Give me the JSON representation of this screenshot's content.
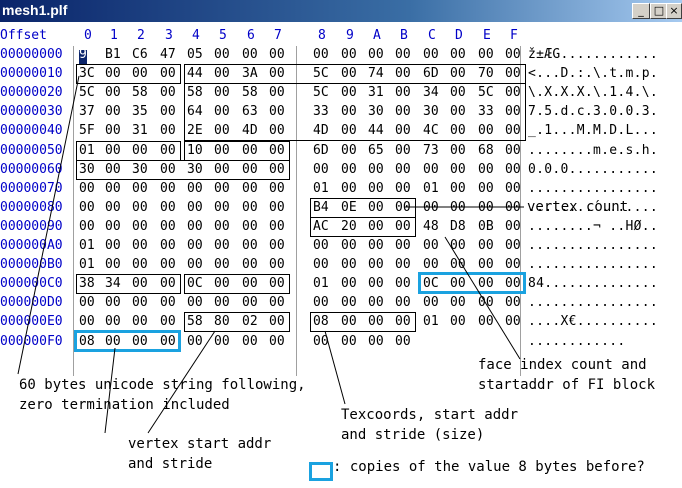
{
  "window": {
    "title": "mesh1.plf",
    "buttons": {
      "minimize": "_",
      "maximize": "□",
      "close": "×"
    }
  },
  "columns": {
    "offset_label": "Offset",
    "headers": [
      "0",
      "1",
      "2",
      "3",
      "4",
      "5",
      "6",
      "7",
      "8",
      "9",
      "A",
      "B",
      "C",
      "D",
      "E",
      "F"
    ]
  },
  "rows": [
    {
      "offset": "00000000",
      "bytes": [
        "9E",
        "B1",
        "C6",
        "47",
        "05",
        "00",
        "00",
        "00",
        "00",
        "00",
        "00",
        "00",
        "00",
        "00",
        "00",
        "00"
      ],
      "ascii": "ž±ÆG............"
    },
    {
      "offset": "00000010",
      "bytes": [
        "3C",
        "00",
        "00",
        "00",
        "44",
        "00",
        "3A",
        "00",
        "5C",
        "00",
        "74",
        "00",
        "6D",
        "00",
        "70",
        "00"
      ],
      "ascii": "<...D.:.\\.t.m.p."
    },
    {
      "offset": "00000020",
      "bytes": [
        "5C",
        "00",
        "58",
        "00",
        "58",
        "00",
        "58",
        "00",
        "5C",
        "00",
        "31",
        "00",
        "34",
        "00",
        "5C",
        "00"
      ],
      "ascii": "\\.X.X.X.\\.1.4.\\."
    },
    {
      "offset": "00000030",
      "bytes": [
        "37",
        "00",
        "35",
        "00",
        "64",
        "00",
        "63",
        "00",
        "33",
        "00",
        "30",
        "00",
        "30",
        "00",
        "33",
        "00"
      ],
      "ascii": "7.5.d.c.3.0.0.3."
    },
    {
      "offset": "00000040",
      "bytes": [
        "5F",
        "00",
        "31",
        "00",
        "2E",
        "00",
        "4D",
        "00",
        "4D",
        "00",
        "44",
        "00",
        "4C",
        "00",
        "00",
        "00"
      ],
      "ascii": "_.1...M.M.D.L..."
    },
    {
      "offset": "00000050",
      "bytes": [
        "01",
        "00",
        "00",
        "00",
        "10",
        "00",
        "00",
        "00",
        "6D",
        "00",
        "65",
        "00",
        "73",
        "00",
        "68",
        "00"
      ],
      "ascii": "........m.e.s.h."
    },
    {
      "offset": "00000060",
      "bytes": [
        "30",
        "00",
        "30",
        "00",
        "30",
        "00",
        "00",
        "00",
        "00",
        "00",
        "00",
        "00",
        "00",
        "00",
        "00",
        "00"
      ],
      "ascii": "0.0.0..........."
    },
    {
      "offset": "00000070",
      "bytes": [
        "00",
        "00",
        "00",
        "00",
        "00",
        "00",
        "00",
        "00",
        "01",
        "00",
        "00",
        "00",
        "01",
        "00",
        "00",
        "00"
      ],
      "ascii": "................"
    },
    {
      "offset": "00000080",
      "bytes": [
        "00",
        "00",
        "00",
        "00",
        "00",
        "00",
        "00",
        "00",
        "B4",
        "0E",
        "00",
        "00",
        "00",
        "00",
        "00",
        "00"
      ],
      "ascii": "........´......."
    },
    {
      "offset": "00000090",
      "bytes": [
        "00",
        "00",
        "00",
        "00",
        "00",
        "00",
        "00",
        "00",
        "AC",
        "20",
        "00",
        "00",
        "48",
        "D8",
        "0B",
        "00"
      ],
      "ascii": "........¬ ..HØ.."
    },
    {
      "offset": "000000A0",
      "bytes": [
        "01",
        "00",
        "00",
        "00",
        "00",
        "00",
        "00",
        "00",
        "00",
        "00",
        "00",
        "00",
        "00",
        "00",
        "00",
        "00"
      ],
      "ascii": "................"
    },
    {
      "offset": "000000B0",
      "bytes": [
        "01",
        "00",
        "00",
        "00",
        "00",
        "00",
        "00",
        "00",
        "00",
        "00",
        "00",
        "00",
        "00",
        "00",
        "00",
        "00"
      ],
      "ascii": "................"
    },
    {
      "offset": "000000C0",
      "bytes": [
        "38",
        "34",
        "00",
        "00",
        "0C",
        "00",
        "00",
        "00",
        "01",
        "00",
        "00",
        "00",
        "0C",
        "00",
        "00",
        "00"
      ],
      "ascii": "84.............."
    },
    {
      "offset": "000000D0",
      "bytes": [
        "00",
        "00",
        "00",
        "00",
        "00",
        "00",
        "00",
        "00",
        "00",
        "00",
        "00",
        "00",
        "00",
        "00",
        "00",
        "00"
      ],
      "ascii": "................"
    },
    {
      "offset": "000000E0",
      "bytes": [
        "00",
        "00",
        "00",
        "00",
        "58",
        "80",
        "02",
        "00",
        "08",
        "00",
        "00",
        "00",
        "01",
        "00",
        "00",
        "00"
      ],
      "ascii": "....X€.........."
    },
    {
      "offset": "000000F0",
      "bytes": [
        "08",
        "00",
        "00",
        "00",
        "00",
        "00",
        "00",
        "00",
        "00",
        "00",
        "00",
        "00",
        "",
        "",
        "",
        ""
      ],
      "ascii": "............"
    }
  ],
  "annotations": {
    "vertex_count": "vertex count",
    "face_index": "face index count and\nstartaddr of FI block",
    "unicode_string": "60 bytes unicode string following,\nzero termination included",
    "texcoords": "Texcoords, start addr\nand stride (size)",
    "vertex_start": "vertex start addr\nand stride",
    "legend": ": copies of the value 8 bytes before?"
  },
  "colors": {
    "offset": "#0000c8",
    "blue_box": "#1aa2e0",
    "titlebar": "#0a246a"
  }
}
